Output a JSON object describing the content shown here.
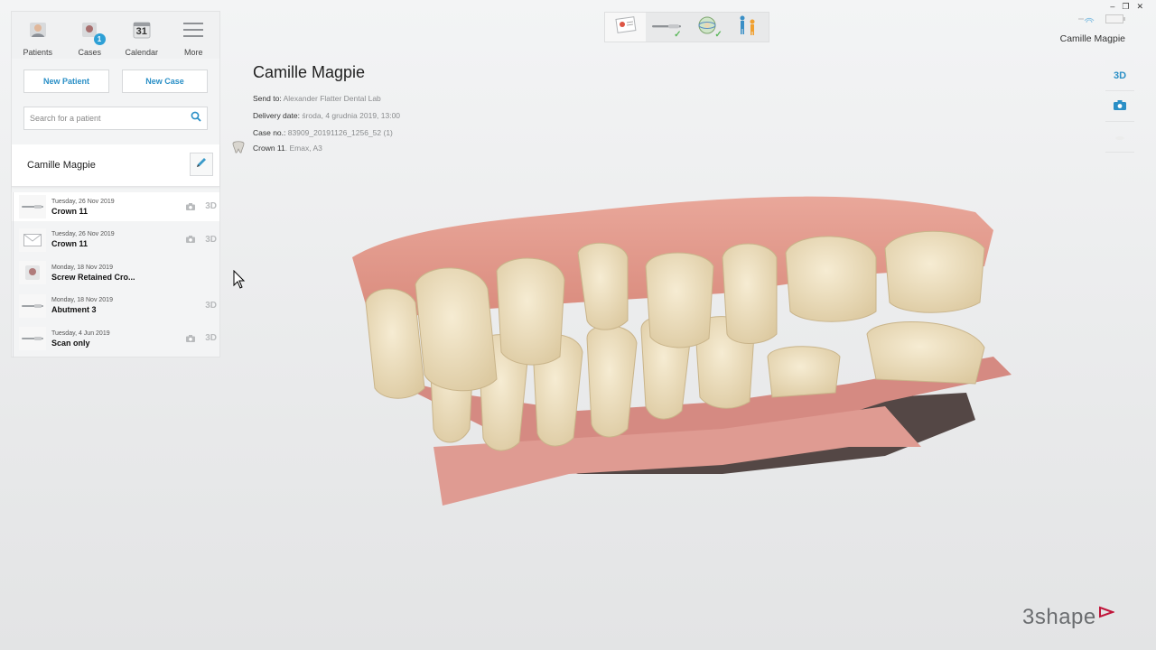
{
  "nav": {
    "items": [
      {
        "label": "Patients",
        "icon": "patients-icon"
      },
      {
        "label": "Cases",
        "icon": "cases-icon",
        "badge": "1"
      },
      {
        "label": "Calendar",
        "icon": "calendar-icon",
        "day": "31"
      },
      {
        "label": "More",
        "icon": "menu-icon"
      }
    ]
  },
  "actions": {
    "new_patient": "New Patient",
    "new_case": "New Case"
  },
  "search": {
    "placeholder": "Search for a patient"
  },
  "patient": {
    "name": "Camille Magpie"
  },
  "cases": [
    {
      "date": "Tuesday, 26 Nov 2019",
      "title": "Crown 11",
      "thumb": "scanner-thumb-icon",
      "photo": true,
      "has3d": true,
      "selected": true
    },
    {
      "date": "Tuesday, 26 Nov 2019",
      "title": "Crown 11",
      "thumb": "envelope-thumb-icon",
      "photo": true,
      "has3d": true,
      "selected": false
    },
    {
      "date": "Monday, 18 Nov 2019",
      "title": "Screw Retained Cro...",
      "thumb": "tooth-thumb-icon",
      "photo": false,
      "has3d": false,
      "selected": false
    },
    {
      "date": "Monday, 18 Nov 2019",
      "title": "Abutment 3",
      "thumb": "scanner-thumb-icon",
      "photo": false,
      "has3d": true,
      "selected": false
    },
    {
      "date": "Tuesday, 4 Jun 2019",
      "title": "Scan only",
      "thumb": "scanner-thumb-icon",
      "photo": true,
      "has3d": true,
      "selected": false
    }
  ],
  "tag_3d": "3D",
  "header": {
    "title": "Camille Magpie",
    "send_to_label": "Send to:",
    "send_to": "Alexander Flatter Dental Lab",
    "delivery_label": "Delivery date:",
    "delivery": "środa, 4 grudnia 2019, 13:00",
    "case_no_label": "Case no.:",
    "case_no": "83909_20191126_1256_52 (1)",
    "crown_label": "Crown 11",
    "crown_detail": ". Emax, A3"
  },
  "workflow": [
    "order-form-step",
    "scan-step",
    "post-processing-step",
    "send-step"
  ],
  "top_right_user": "Camille Magpie",
  "view": {
    "label_3d": "3D"
  },
  "logo": "3shape",
  "colors": {
    "accent": "#2a8fc6",
    "badge": "#2ea0d6",
    "logo_triangle": "#c0163b"
  }
}
